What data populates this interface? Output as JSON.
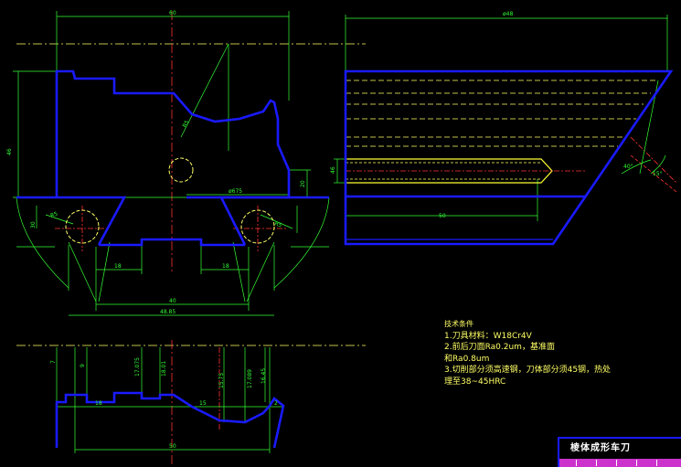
{
  "dims": {
    "top_width": "60",
    "right_width": "ø48",
    "height_46": "46",
    "d_675": "ø675",
    "d_20": "20",
    "d_18a": "18",
    "d_18b": "18",
    "d_40": "40",
    "d_bottom_total": "48.85",
    "d_r5a": "R5",
    "d_r5b": "R5",
    "d_r5c": "R5",
    "d_30": "30",
    "d_46b": "46",
    "d_50": "50",
    "angle_40": "40°",
    "angle_15": "15°",
    "p_7": "7",
    "p_9": "9",
    "p_18": "18",
    "p_15": "15",
    "p_175": "17.075",
    "p_181": "18.01",
    "p_2": "2",
    "p_1575": "15.75",
    "p_1708": "17.089",
    "p_1643": "16.45",
    "p_50": "50"
  },
  "notes": {
    "title": "技术条件",
    "line1": "1.刀具材料：W18Cr4V",
    "line2": "2.前后刀面Ra0.2um，基准面",
    "line3": "和Ra0.8um",
    "line4": "3.切削部分须高速钢，刀体部分须45钢，热处",
    "line5": "理至38~45HRC"
  },
  "title_block": {
    "title": "棱体成形车刀"
  },
  "colors": {
    "outline": "#1a1aff",
    "dimension": "#33ff33",
    "centerline": "#ff3333",
    "hidden": "#ffff66",
    "background": "#000000"
  }
}
